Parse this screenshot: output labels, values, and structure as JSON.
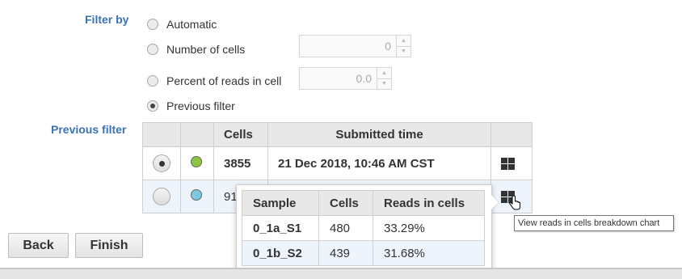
{
  "filter": {
    "label": "Filter by",
    "options": [
      {
        "label": "Automatic",
        "checked": false
      },
      {
        "label": "Number of cells",
        "checked": false,
        "value": "0"
      },
      {
        "label": "Percent of reads in cell",
        "checked": false,
        "value": "0.0"
      },
      {
        "label": "Previous filter",
        "checked": true
      }
    ]
  },
  "previous_filter": {
    "label": "Previous filter",
    "columns": [
      "",
      "",
      "Cells",
      "Submitted time",
      ""
    ],
    "rows": [
      {
        "selected": true,
        "color": "#8dc63f",
        "cells": "3855",
        "submitted": "21 Dec 2018, 10:46 AM CST",
        "icon": "grid-icon"
      },
      {
        "selected": false,
        "color": "#7ec8e3",
        "cells": "91",
        "submitted": "",
        "icon": "grid-icon"
      }
    ]
  },
  "popup": {
    "columns": [
      "Sample",
      "Cells",
      "Reads in cells"
    ],
    "rows": [
      {
        "sample": "0_1a_S1",
        "cells": "480",
        "reads": "33.29%"
      },
      {
        "sample": "0_1b_S2",
        "cells": "439",
        "reads": "31.68%"
      }
    ]
  },
  "tooltip": "View reads in cells breakdown chart",
  "buttons": {
    "back": "Back",
    "finish": "Finish"
  },
  "colors": {
    "accent": "#3a73b0"
  }
}
